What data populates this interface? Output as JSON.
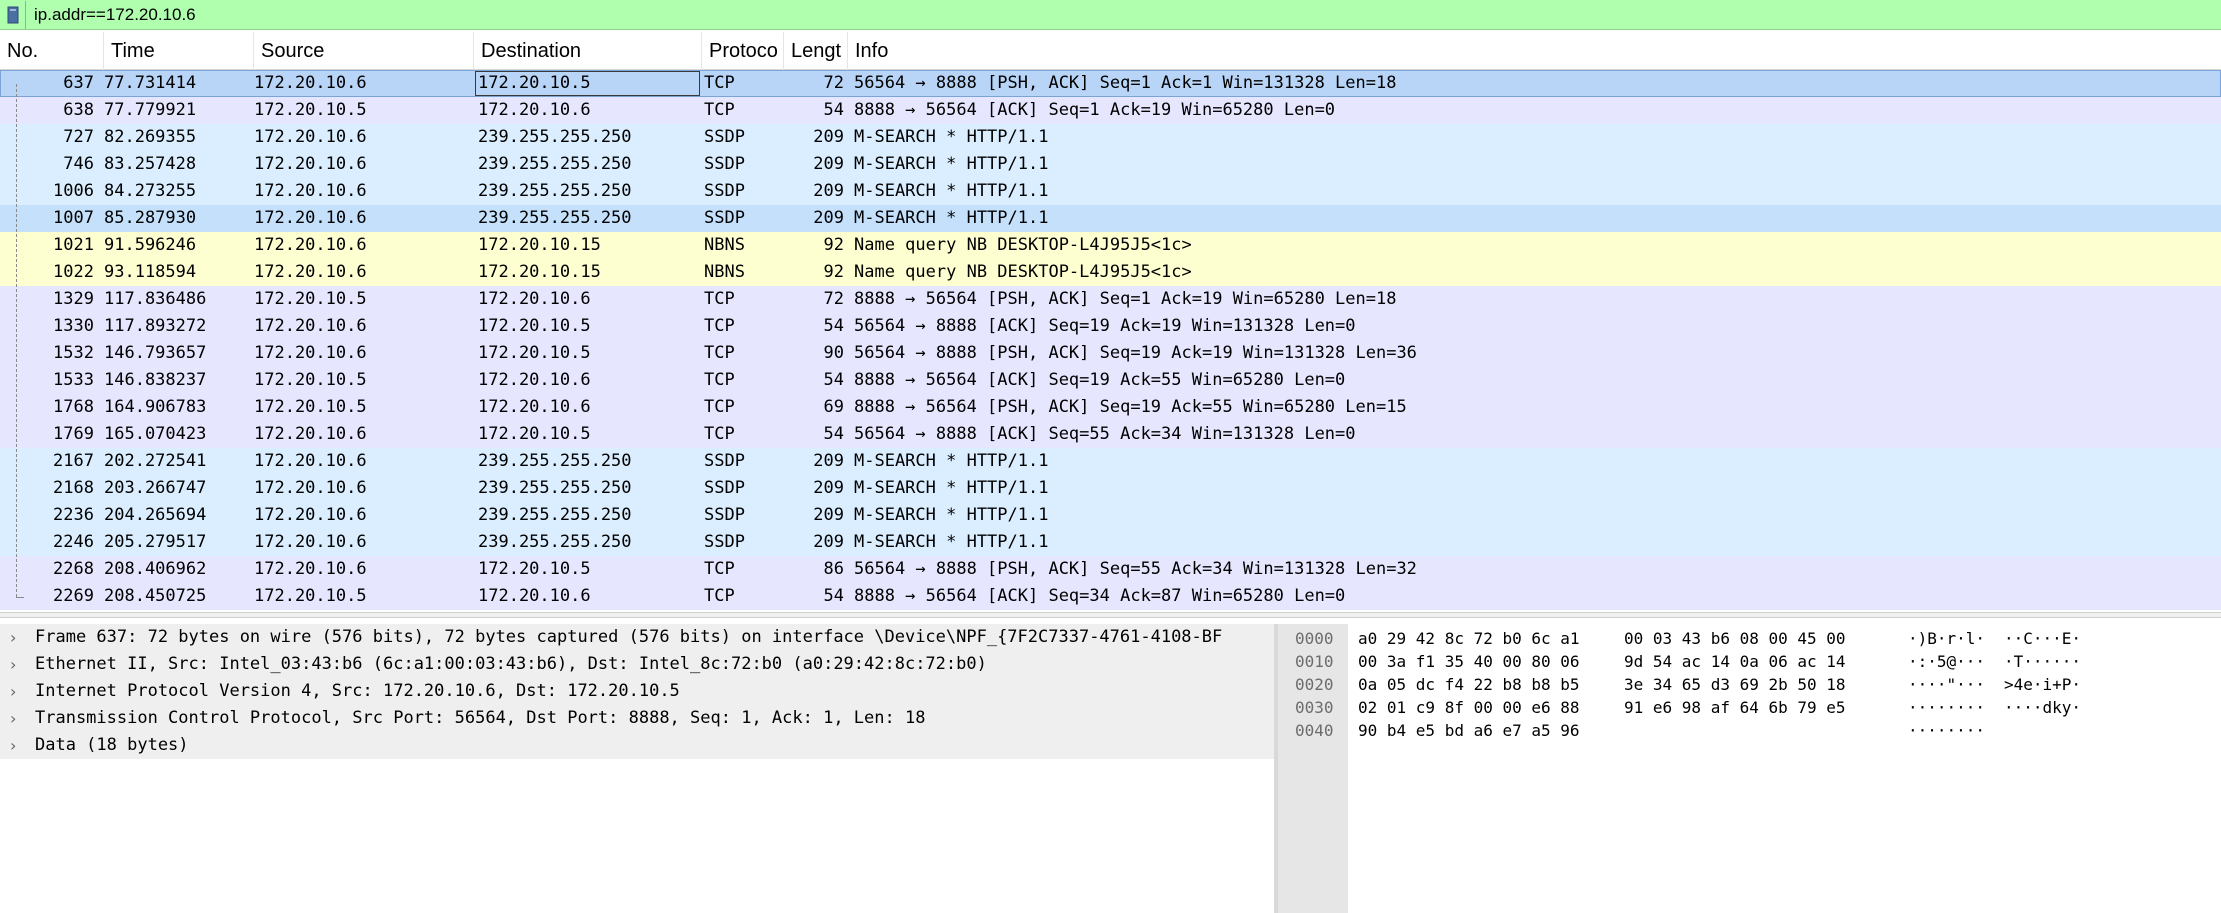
{
  "filter": {
    "expression": "ip.addr==172.20.10.6",
    "bookmark_icon": "bookmark-icon"
  },
  "packet_list": {
    "columns": [
      "No.",
      "Time",
      "Source",
      "Destination",
      "Protoco",
      "Lengt",
      "Info"
    ],
    "rows": [
      {
        "no": "637",
        "time": "77.731414",
        "src": "172.20.10.6",
        "dst": "172.20.10.5",
        "proto": "TCP",
        "len": "72",
        "info": "56564 → 8888 [PSH, ACK] Seq=1 Ack=1 Win=131328 Len=18",
        "style": "selected"
      },
      {
        "no": "638",
        "time": "77.779921",
        "src": "172.20.10.5",
        "dst": "172.20.10.6",
        "proto": "TCP",
        "len": "54",
        "info": "8888 → 56564 [ACK] Seq=1 Ack=19 Win=65280 Len=0",
        "style": "tcp"
      },
      {
        "no": "727",
        "time": "82.269355",
        "src": "172.20.10.6",
        "dst": "239.255.255.250",
        "proto": "SSDP",
        "len": "209",
        "info": "M-SEARCH * HTTP/1.1",
        "style": "ssdp"
      },
      {
        "no": "746",
        "time": "83.257428",
        "src": "172.20.10.6",
        "dst": "239.255.255.250",
        "proto": "SSDP",
        "len": "209",
        "info": "M-SEARCH * HTTP/1.1",
        "style": "ssdp"
      },
      {
        "no": "1006",
        "time": "84.273255",
        "src": "172.20.10.6",
        "dst": "239.255.255.250",
        "proto": "SSDP",
        "len": "209",
        "info": "M-SEARCH * HTTP/1.1",
        "style": "ssdp"
      },
      {
        "no": "1007",
        "time": "85.287930",
        "src": "172.20.10.6",
        "dst": "239.255.255.250",
        "proto": "SSDP",
        "len": "209",
        "info": "M-SEARCH * HTTP/1.1",
        "style": "ssdp alt"
      },
      {
        "no": "1021",
        "time": "91.596246",
        "src": "172.20.10.6",
        "dst": "172.20.10.15",
        "proto": "NBNS",
        "len": "92",
        "info": "Name query NB DESKTOP-L4J95J5<1c>",
        "style": "nbns"
      },
      {
        "no": "1022",
        "time": "93.118594",
        "src": "172.20.10.6",
        "dst": "172.20.10.15",
        "proto": "NBNS",
        "len": "92",
        "info": "Name query NB DESKTOP-L4J95J5<1c>",
        "style": "nbns"
      },
      {
        "no": "1329",
        "time": "117.836486",
        "src": "172.20.10.5",
        "dst": "172.20.10.6",
        "proto": "TCP",
        "len": "72",
        "info": "8888 → 56564 [PSH, ACK] Seq=1 Ack=19 Win=65280 Len=18",
        "style": "tcp"
      },
      {
        "no": "1330",
        "time": "117.893272",
        "src": "172.20.10.6",
        "dst": "172.20.10.5",
        "proto": "TCP",
        "len": "54",
        "info": "56564 → 8888 [ACK] Seq=19 Ack=19 Win=131328 Len=0",
        "style": "tcp"
      },
      {
        "no": "1532",
        "time": "146.793657",
        "src": "172.20.10.6",
        "dst": "172.20.10.5",
        "proto": "TCP",
        "len": "90",
        "info": "56564 → 8888 [PSH, ACK] Seq=19 Ack=19 Win=131328 Len=36",
        "style": "tcp"
      },
      {
        "no": "1533",
        "time": "146.838237",
        "src": "172.20.10.5",
        "dst": "172.20.10.6",
        "proto": "TCP",
        "len": "54",
        "info": "8888 → 56564 [ACK] Seq=19 Ack=55 Win=65280 Len=0",
        "style": "tcp"
      },
      {
        "no": "1768",
        "time": "164.906783",
        "src": "172.20.10.5",
        "dst": "172.20.10.6",
        "proto": "TCP",
        "len": "69",
        "info": "8888 → 56564 [PSH, ACK] Seq=19 Ack=55 Win=65280 Len=15",
        "style": "tcp"
      },
      {
        "no": "1769",
        "time": "165.070423",
        "src": "172.20.10.6",
        "dst": "172.20.10.5",
        "proto": "TCP",
        "len": "54",
        "info": "56564 → 8888 [ACK] Seq=55 Ack=34 Win=131328 Len=0",
        "style": "tcp"
      },
      {
        "no": "2167",
        "time": "202.272541",
        "src": "172.20.10.6",
        "dst": "239.255.255.250",
        "proto": "SSDP",
        "len": "209",
        "info": "M-SEARCH * HTTP/1.1",
        "style": "ssdp"
      },
      {
        "no": "2168",
        "time": "203.266747",
        "src": "172.20.10.6",
        "dst": "239.255.255.250",
        "proto": "SSDP",
        "len": "209",
        "info": "M-SEARCH * HTTP/1.1",
        "style": "ssdp"
      },
      {
        "no": "2236",
        "time": "204.265694",
        "src": "172.20.10.6",
        "dst": "239.255.255.250",
        "proto": "SSDP",
        "len": "209",
        "info": "M-SEARCH * HTTP/1.1",
        "style": "ssdp"
      },
      {
        "no": "2246",
        "time": "205.279517",
        "src": "172.20.10.6",
        "dst": "239.255.255.250",
        "proto": "SSDP",
        "len": "209",
        "info": "M-SEARCH * HTTP/1.1",
        "style": "ssdp"
      },
      {
        "no": "2268",
        "time": "208.406962",
        "src": "172.20.10.6",
        "dst": "172.20.10.5",
        "proto": "TCP",
        "len": "86",
        "info": "56564 → 8888 [PSH, ACK] Seq=55 Ack=34 Win=131328 Len=32",
        "style": "tcp"
      },
      {
        "no": "2269",
        "time": "208.450725",
        "src": "172.20.10.5",
        "dst": "172.20.10.6",
        "proto": "TCP",
        "len": "54",
        "info": "8888 → 56564 [ACK] Seq=34 Ack=87 Win=65280 Len=0",
        "style": "tcp"
      }
    ]
  },
  "details": {
    "items": [
      "Frame 637: 72 bytes on wire (576 bits), 72 bytes captured (576 bits) on interface \\Device\\NPF_{7F2C7337-4761-4108-BF",
      "Ethernet II, Src: Intel_03:43:b6 (6c:a1:00:03:43:b6), Dst: Intel_8c:72:b0 (a0:29:42:8c:72:b0)",
      "Internet Protocol Version 4, Src: 172.20.10.6, Dst: 172.20.10.5",
      "Transmission Control Protocol, Src Port: 56564, Dst Port: 8888, Seq: 1, Ack: 1, Len: 18",
      "Data (18 bytes)"
    ],
    "expander_icon": "chevron-right-icon"
  },
  "bytes": {
    "rows": [
      {
        "offset": "0000",
        "hex1": "a0 29 42 8c 72 b0 6c a1",
        "hex2": "00 03 43 b6 08 00 45 00",
        "ascii1": "·)B·r·l·",
        "ascii2": "··C···E·"
      },
      {
        "offset": "0010",
        "hex1": "00 3a f1 35 40 00 80 06",
        "hex2": "9d 54 ac 14 0a 06 ac 14",
        "ascii1": "·:·5@···",
        "ascii2": "·T······"
      },
      {
        "offset": "0020",
        "hex1": "0a 05 dc f4 22 b8 b8 b5",
        "hex2": "3e 34 65 d3 69 2b 50 18",
        "ascii1": "····\"···",
        "ascii2": ">4e·i+P·"
      },
      {
        "offset": "0030",
        "hex1": "02 01 c9 8f 00 00 e6 88",
        "hex2": "91 e6 98 af 64 6b 79 e5",
        "ascii1": "········",
        "ascii2": "····dky·"
      },
      {
        "offset": "0040",
        "hex1": "90 b4 e5 bd a6 e7 a5 96",
        "hex2": "",
        "ascii1": "········",
        "ascii2": ""
      }
    ]
  }
}
